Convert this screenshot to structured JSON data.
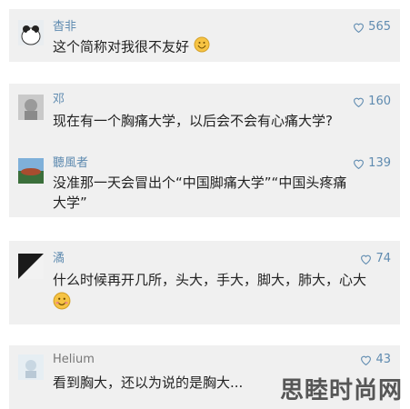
{
  "comments": [
    {
      "user": "杳非",
      "likes": "565",
      "text": "这个简称对我很不友好"
    },
    {
      "user": "邓",
      "likes": "160",
      "text": "现在有一个胸痛大学，以后会不会有心痛大学?"
    },
    {
      "user": "聽風者",
      "likes": "139",
      "text1": "没准那一天会冒出个“中国脚痛大学”“中国头疼痛",
      "text2": "大学”"
    },
    {
      "user": "潏",
      "likes": "74",
      "text": "什么时候再开几所，头大，手大，脚大，肺大，心大"
    },
    {
      "user": "Helium",
      "likes": "43",
      "text": "看到胸大，还以为说的是胸大..."
    }
  ],
  "watermark": "思睦时尚网",
  "colors": {
    "card_bg": "#f0f0f0",
    "link": "#5f8bb0",
    "text": "#222222"
  },
  "icons": {
    "like": "heart-outline-icon",
    "emoji_smile": "smiling-emoji-icon"
  }
}
